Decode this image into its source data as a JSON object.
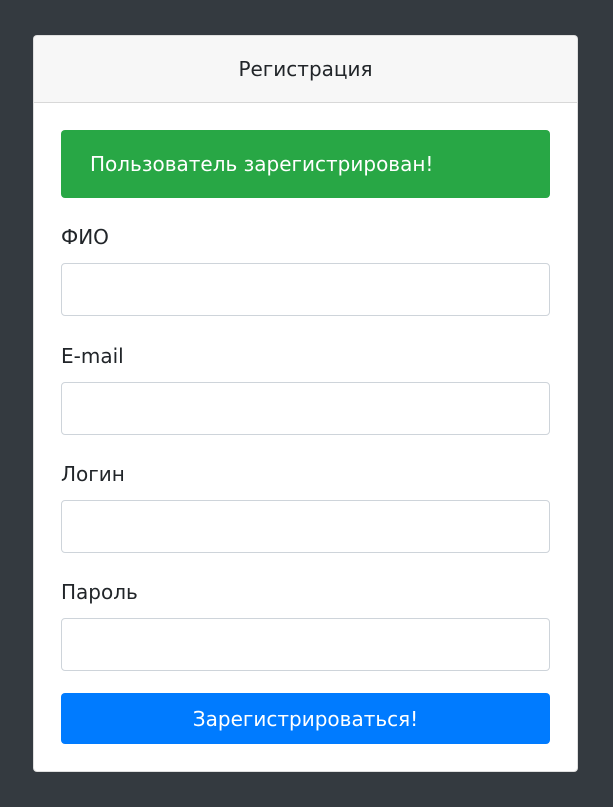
{
  "card": {
    "title": "Регистрация"
  },
  "alert": {
    "message": "Пользователь зарегистрирован!",
    "color": "#28a745"
  },
  "form": {
    "fields": [
      {
        "label": "ФИО",
        "value": "",
        "placeholder": ""
      },
      {
        "label": "E-mail",
        "value": "",
        "placeholder": ""
      },
      {
        "label": "Логин",
        "value": "",
        "placeholder": ""
      },
      {
        "label": "Пароль",
        "value": "",
        "placeholder": ""
      }
    ],
    "submit_label": "Зарегистрироваться!",
    "submit_color": "#007bff"
  },
  "colors": {
    "background": "#343a40",
    "card_header": "#f7f7f7"
  }
}
